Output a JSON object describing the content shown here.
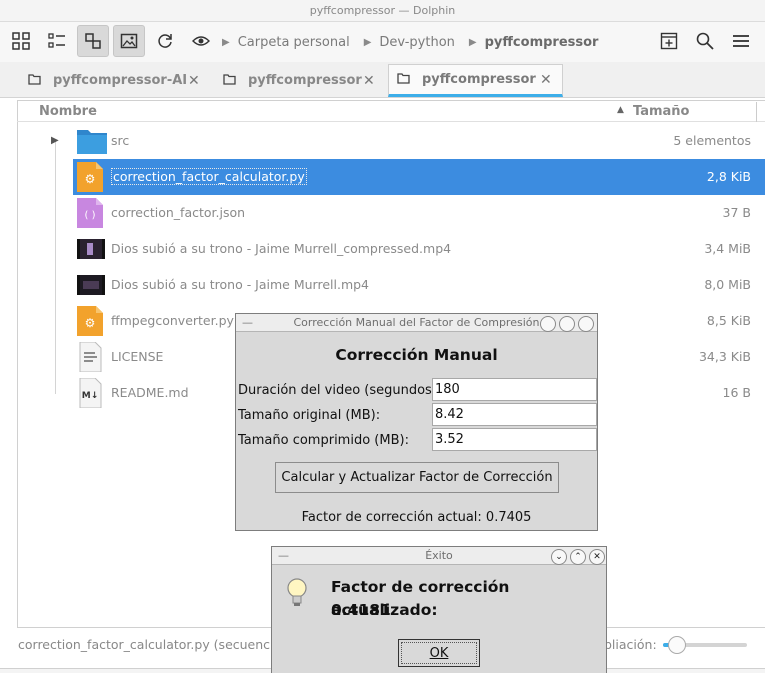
{
  "window": {
    "title": "pyffcompressor — Dolphin"
  },
  "toolbar": {
    "icons": [
      "icons-view-icon",
      "compact-view-icon",
      "split-view-icon",
      "preview-icon",
      "reload-icon",
      "eye-icon",
      "new-tab-icon",
      "search-icon",
      "menu-icon"
    ],
    "breadcrumbs": [
      "Carpeta personal",
      "Dev-python",
      "pyffcompressor"
    ]
  },
  "tabs": [
    {
      "label": "pyffcompressor-AI"
    },
    {
      "label": "pyffcompressor"
    },
    {
      "label": "pyffcompressor",
      "active": true
    }
  ],
  "columns": {
    "name": "Nombre",
    "size": "Tamaño"
  },
  "files": [
    {
      "name": "src",
      "size": "5 elementos",
      "icon": "folder-icon"
    },
    {
      "name": "correction_factor_calculator.py",
      "size": "2,8 KiB",
      "icon": "python-file-icon",
      "selected": true
    },
    {
      "name": "correction_factor.json",
      "size": "37 B",
      "icon": "json-file-icon"
    },
    {
      "name": "Dios subió a su trono - Jaime Murrell_compressed.mp4",
      "size": "3,4 MiB",
      "icon": "video-thumbnail-icon"
    },
    {
      "name": "Dios subió a su trono - Jaime Murrell.mp4",
      "size": "8,0 MiB",
      "icon": "video-thumbnail-icon"
    },
    {
      "name": "ffmpegconverter.py",
      "size": "8,5 KiB",
      "icon": "python-file-icon"
    },
    {
      "name": "LICENSE",
      "size": "34,3 KiB",
      "icon": "text-file-icon"
    },
    {
      "name": "README.md",
      "size": "16 B",
      "icon": "markdown-file-icon"
    }
  ],
  "status": {
    "text": "correction_factor_calculator.py (secuencia",
    "zoom_label": "pliación:",
    "zoom_fraction": 0.17
  },
  "dialog_correction": {
    "title": "Corrección Manual del Factor de Compresión",
    "heading": "Corrección Manual",
    "duration_label": "Duración del video (segundos):",
    "duration_value": "180",
    "original_label": "Tamaño original (MB):",
    "original_value": "8.42",
    "compressed_label": "Tamaño comprimido (MB):",
    "compressed_value": "3.52",
    "button_label": "Calcular y Actualizar Factor de Corrección",
    "result_text": "Factor de corrección actual: 0.7405"
  },
  "dialog_success": {
    "title": "Éxito",
    "message_line1": "Factor de corrección actualizado:",
    "message_line2": "0.4181",
    "ok_label": "OK"
  },
  "colors": {
    "selection": "#3c8ce0",
    "accent": "#3daee9",
    "folder": "#3c9ee0",
    "python": "#f2a22c",
    "json": "#c887e0"
  }
}
